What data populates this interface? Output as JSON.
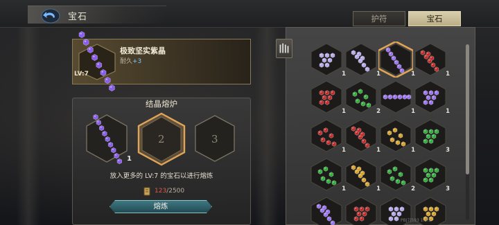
{
  "header": {
    "title": "宝石"
  },
  "tabs": [
    {
      "label": "护符",
      "active": false
    },
    {
      "label": "宝石",
      "active": true
    }
  ],
  "item": {
    "name": "极致坚实紫晶",
    "durability_label": "耐久",
    "durability_bonus": "+3",
    "level": "LV:7",
    "gem_color": "#8a5cf0"
  },
  "furnace": {
    "title": "结晶熔炉",
    "slots": [
      {
        "label": "",
        "count": "1",
        "filled": true
      },
      {
        "label": "2",
        "selected": true
      },
      {
        "label": "3"
      }
    ],
    "hint": "放入更多的 LV:7 的宝石以进行熔炼",
    "cost_current": "123",
    "cost_total": "/2500",
    "button": "熔炼"
  },
  "sort_icon": "sort-bars-icon",
  "colors": {
    "purple": "#9a72f2",
    "lilac": "#b7a8ec",
    "red": "#c42a2a",
    "green": "#2fae3a",
    "yellow": "#d7a22a",
    "gold_border": "#e0a456",
    "button": "#3f7882"
  },
  "gems": [
    {
      "color": "lilac",
      "shape": "cluster",
      "count": "1"
    },
    {
      "color": "lilac",
      "shape": "chain",
      "count": "1"
    },
    {
      "color": "purple",
      "shape": "line",
      "count": "1",
      "selected": true
    },
    {
      "color": "red",
      "shape": "chain",
      "count": "1"
    },
    {
      "color": "red",
      "shape": "cluster",
      "count": "1"
    },
    {
      "color": "green",
      "shape": "scatter",
      "count": "2"
    },
    {
      "color": "purple",
      "shape": "row",
      "count": "1"
    },
    {
      "color": "purple",
      "shape": "cluster",
      "count": "1"
    },
    {
      "color": "red",
      "shape": "scatter",
      "count": "1"
    },
    {
      "color": "red",
      "shape": "chain",
      "count": "1"
    },
    {
      "color": "yellow",
      "shape": "scatter",
      "count": "1"
    },
    {
      "color": "green",
      "shape": "cluster",
      "count": "3"
    },
    {
      "color": "green",
      "shape": "scatter",
      "count": "1"
    },
    {
      "color": "yellow",
      "shape": "chain",
      "count": "1"
    },
    {
      "color": "green",
      "shape": "scatter",
      "count": "2"
    },
    {
      "color": "green",
      "shape": "cluster",
      "count": "3"
    },
    {
      "color": "purple",
      "shape": "chain",
      "count": ""
    },
    {
      "color": "red",
      "shape": "cluster",
      "count": ""
    },
    {
      "color": "lilac",
      "shape": "cluster",
      "count": ""
    },
    {
      "color": "yellow",
      "shape": "cluster",
      "count": ""
    }
  ],
  "footer": "PBJ7|593  1.3.1"
}
